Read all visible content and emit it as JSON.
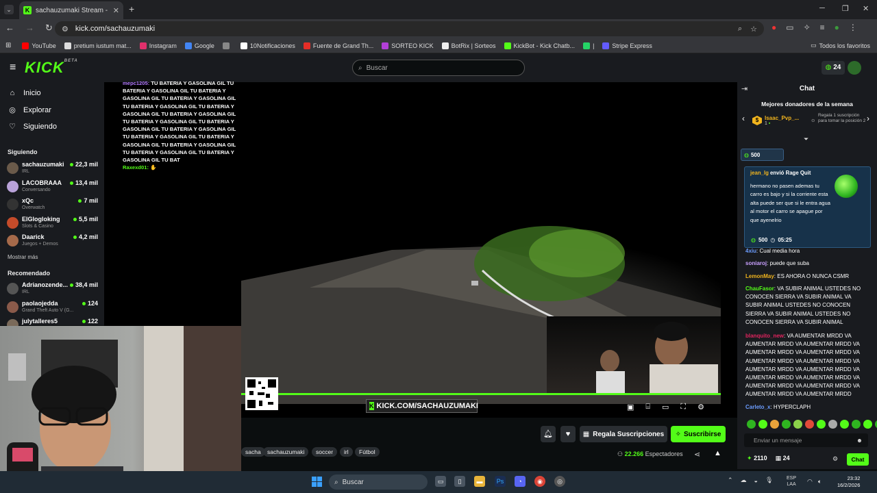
{
  "browser": {
    "tab_title": "sachauzumaki Stream - Watch",
    "url": "kick.com/sachauzumaki",
    "bookmarks": [
      {
        "label": "YouTube",
        "color": "#ff0000"
      },
      {
        "label": "pretium iustum mat...",
        "color": "#dddddd"
      },
      {
        "label": "Instagram",
        "color": "#e1306c"
      },
      {
        "label": "Google",
        "color": "#4285f4"
      },
      {
        "label": "",
        "color": "#888888"
      },
      {
        "label": "10Notificaciones",
        "color": "#ffffff"
      },
      {
        "label": "Fuente de Grand Th...",
        "color": "#e52d27"
      },
      {
        "label": "SORTEO KICK",
        "color": "#b23fd8"
      },
      {
        "label": "BotRix | Sorteos",
        "color": "#eeeeee"
      },
      {
        "label": "KickBot - Kick Chatb...",
        "color": "#53fc18"
      },
      {
        "label": "|",
        "color": "#25d366"
      },
      {
        "label": "Stripe Express",
        "color": "#635bff"
      }
    ],
    "all_bookmarks": "Todos los favoritos"
  },
  "kick": {
    "logo": "KICK",
    "logo_badge": "BETA",
    "search_placeholder": "Buscar",
    "kicks_count": "24",
    "nav": [
      {
        "label": "Inicio",
        "icon": "home-icon"
      },
      {
        "label": "Explorar",
        "icon": "compass-icon"
      },
      {
        "label": "Siguiendo",
        "icon": "heart-icon"
      }
    ],
    "following_header": "Siguiendo",
    "following": [
      {
        "name": "sachauzumaki",
        "category": "IRL",
        "viewers": "22,3 mil",
        "color": "#6a5a4a"
      },
      {
        "name": "LACOBRAAA",
        "category": "Conversando",
        "viewers": "13,4 mil",
        "color": "#b9a2d9"
      },
      {
        "name": "xQc",
        "category": "Overwatch",
        "viewers": "7 mil",
        "color": "#333333"
      },
      {
        "name": "ElGlogloking",
        "category": "Slots & Casino",
        "viewers": "5,5 mil",
        "color": "#c44b2a"
      },
      {
        "name": "Daarick",
        "category": "Juegos + Demos",
        "viewers": "4,2 mil",
        "color": "#a66a4a"
      }
    ],
    "show_more": "Mostrar más",
    "recommended_header": "Recomendado",
    "recommended": [
      {
        "name": "Adrianozende...",
        "category": "IRL",
        "viewers": "38,4 mil",
        "color": "#555555"
      },
      {
        "name": "paolaojedda",
        "category": "Grand Theft Auto V (G...",
        "viewers": "124",
        "color": "#8a5a4a"
      },
      {
        "name": "julytalleres5",
        "category": "",
        "viewers": "122",
        "color": "#7a6a5a"
      }
    ]
  },
  "stream_overlay": {
    "messages": [
      {
        "user": "mepc1205",
        "text": "TU BATERIA Y GASOLINA GIL TU BATERIA Y GASOLINA GIL TU BATERIA Y GASOLINA GIL TU BATERIA Y GASOLINA GIL TU BATERIA Y GASOLINA GIL TU BATERIA Y GASOLINA GIL TU BATERIA Y GASOLINA GIL TU BATERIA Y GASOLINA GIL TU BATERIA Y GASOLINA GIL TU BATERIA Y GASOLINA GIL TU BATERIA Y GASOLINA GIL TU BATERIA Y GASOLINA GIL TU BATERIA Y GASOLINA GIL TU BATERIA Y GASOLINA GIL TU BATERIA Y GASOLINA GIL TU BAT"
      },
      {
        "user": "Raxexd01",
        "text": ""
      }
    ],
    "banner": "KICK.COM/SACHAUZUMAKI"
  },
  "below_player": {
    "tags": [
      "sacha",
      "sachauzumaki",
      "soccer",
      "irl",
      "Fútbol"
    ],
    "gift_label": "Regala Suscripciones",
    "subscribe_label": "Suscribirse",
    "viewers_count": "22.266",
    "viewers_label": "Espectadores"
  },
  "chat": {
    "title": "Chat",
    "donors_title": "Mejores donadores de la semana",
    "top_donor": {
      "name": "Isaac_Pvp_...",
      "rank": "1"
    },
    "next_slot": "Regala 1 suscripción para tomar la posición 2",
    "pinned_amount": "500",
    "rage": {
      "user": "jean_lg",
      "action": "envió",
      "item": "Rage Quit",
      "message": "hermano no pasen ademas tu carro es bajo y si la corriente esta alta puede ser que si le entra agua al motor el carro se apague por que ayenelrio",
      "amount": "500",
      "time": "05:25"
    },
    "messages": [
      {
        "user": "4xiu",
        "text": "Cual media hora",
        "color": "#6c9dff"
      },
      {
        "user": "soniaroj",
        "text": "puede que suba",
        "color": "#c9a0ff"
      },
      {
        "user": "LemonMay",
        "text": "ES AHORA O NUNCA CSMR",
        "color": "#f2b51e"
      },
      {
        "user": "ChauFasor",
        "text": "VA SUBIR ANIMAL USTEDES NO CONOCEN SIERRA VA SUBIR ANIMAL VA SUBIR ANIMAL USTEDES NO CONOCEN SIERRA VA SUBIR ANIMAL USTEDES NO CONOCEN SIERRA VA SUBIR ANIMAL",
        "color": "#53fc18"
      },
      {
        "user": "blanquito_new",
        "text": "VA AUMENTAR MRDD VA AUMENTAR MRDD VA AUMENTAR MRDD VA AUMENTAR MRDD VA AUMENTAR MRDD VA AUMENTAR MRDD VA AUMENTAR MRDD VA AUMENTAR MRDD VA AUMENTAR MRDD VA AUMENTAR MRDD VA AUMENTAR MRDD VA AUMENTAR MRDD VA AUMENTAR MRDD VA AUMENTAR MRDD VA AUMENTAR MRDD",
        "color": "#e0245e"
      },
      {
        "user": "Carleto_x",
        "text": "HYPERCLAPH",
        "color": "#6c9dff"
      }
    ],
    "input_placeholder": "Enviar un mensaje",
    "points": "2110",
    "gifts": "24",
    "send_label": "Chat"
  },
  "taskbar": {
    "search_placeholder": "Buscar",
    "lang": "ESP",
    "lang_sub": "LAA",
    "time": "23:32",
    "date": "16/2/2026"
  }
}
